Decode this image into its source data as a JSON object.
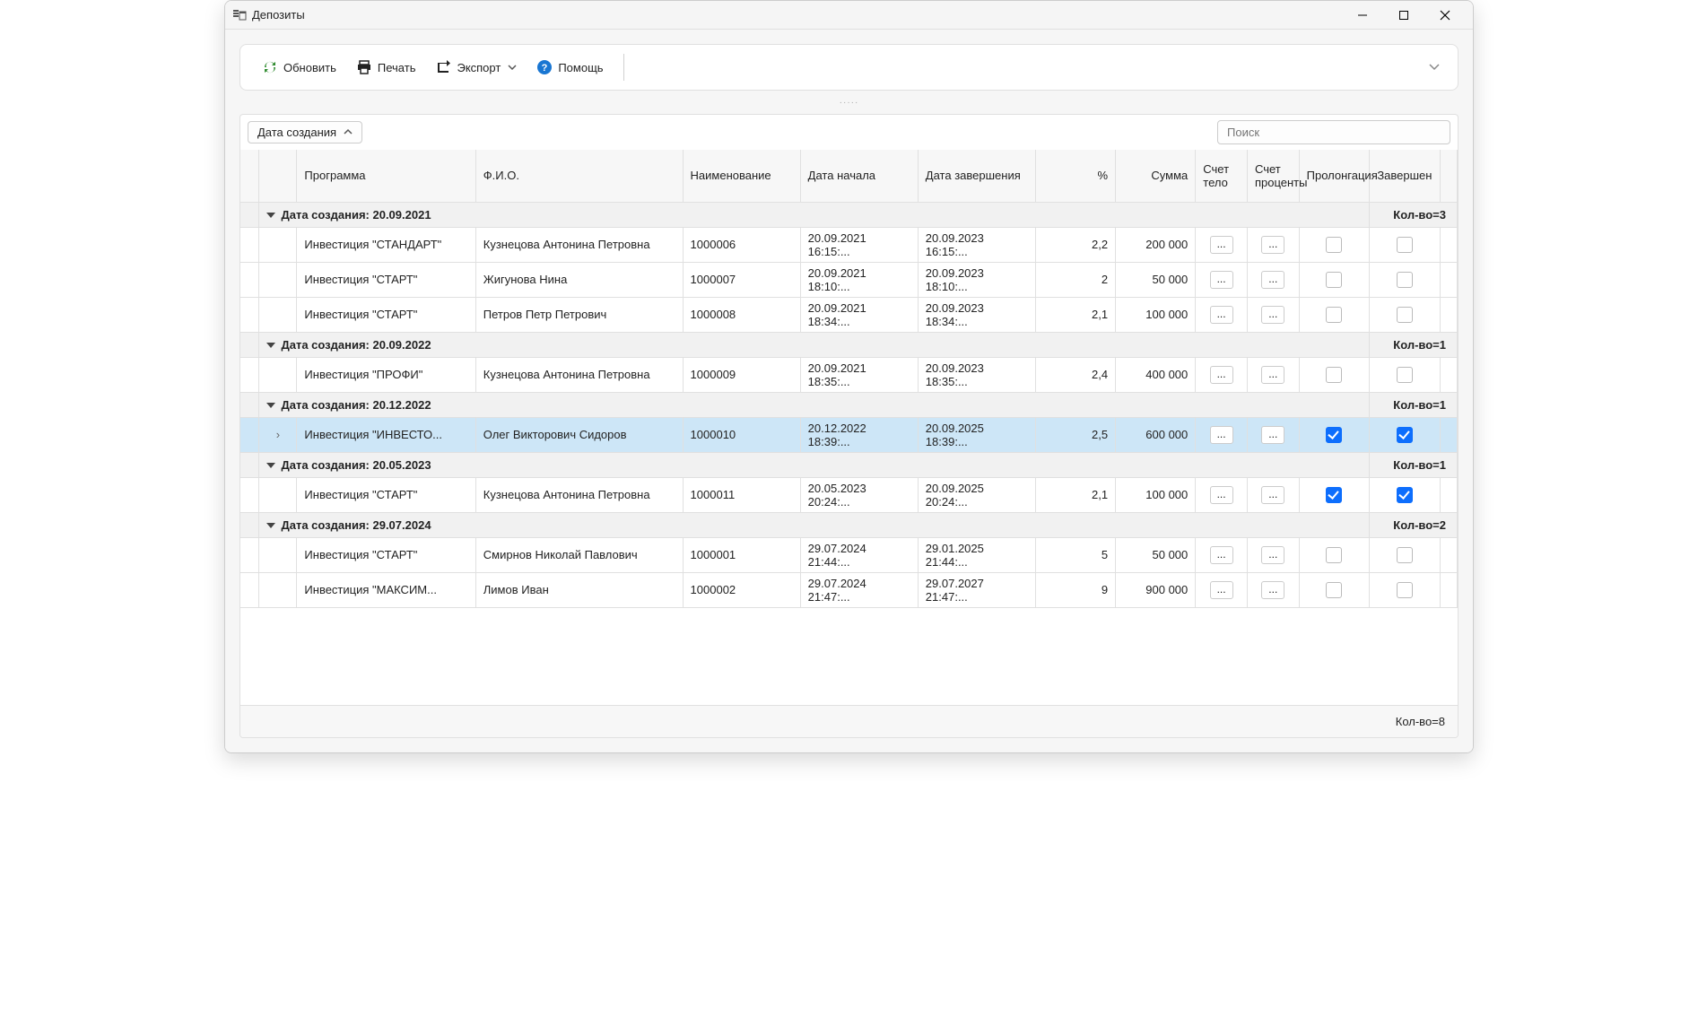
{
  "window": {
    "title": "Депозиты"
  },
  "toolbar": {
    "refresh": "Обновить",
    "print": "Печать",
    "export": "Экспорт",
    "help": "Помощь"
  },
  "group": {
    "chip_label": "Дата создания"
  },
  "search": {
    "placeholder": "Поиск"
  },
  "columns": {
    "program": "Программа",
    "fio": "Ф.И.О.",
    "name": "Наименование",
    "date_start": "Дата начала",
    "date_end": "Дата завершения",
    "percent": "%",
    "sum": "Сумма",
    "acct_body": "Счет тело",
    "acct_pct": "Счет проценты",
    "prolong": "Пролонгация",
    "done": "Завершен"
  },
  "groups": [
    {
      "label": "Дата создания: 20.09.2021",
      "count_label": "Кол-во=3",
      "rows": [
        {
          "program": "Инвестиция \"СТАНДАРТ\"",
          "fio": "Кузнецова Антонина Петровна",
          "name": "1000006",
          "dstart": "20.09.2021 16:15:...",
          "dend": "20.09.2023 16:15:...",
          "pct": "2,2",
          "sum": "200 000",
          "prolong": false,
          "done": false,
          "selected": false
        },
        {
          "program": "Инвестиция \"СТАРТ\"",
          "fio": "Жигунова Нина",
          "name": "1000007",
          "dstart": "20.09.2021 18:10:...",
          "dend": "20.09.2023 18:10:...",
          "pct": "2",
          "sum": "50 000",
          "prolong": false,
          "done": false,
          "selected": false
        },
        {
          "program": "Инвестиция \"СТАРТ\"",
          "fio": "Петров Петр Петрович",
          "name": "1000008",
          "dstart": "20.09.2021 18:34:...",
          "dend": "20.09.2023 18:34:...",
          "pct": "2,1",
          "sum": "100 000",
          "prolong": false,
          "done": false,
          "selected": false
        }
      ]
    },
    {
      "label": "Дата создания: 20.09.2022",
      "count_label": "Кол-во=1",
      "rows": [
        {
          "program": "Инвестиция \"ПРОФИ\"",
          "fio": "Кузнецова Антонина Петровна",
          "name": "1000009",
          "dstart": "20.09.2021 18:35:...",
          "dend": "20.09.2023 18:35:...",
          "pct": "2,4",
          "sum": "400 000",
          "prolong": false,
          "done": false,
          "selected": false
        }
      ]
    },
    {
      "label": "Дата создания: 20.12.2022",
      "count_label": "Кол-во=1",
      "rows": [
        {
          "program": "Инвестиция \"ИНВЕСТО...",
          "fio": "Олег Викторович Сидоров",
          "name": "1000010",
          "dstart": "20.12.2022 18:39:...",
          "dend": "20.09.2025 18:39:...",
          "pct": "2,5",
          "sum": "600 000",
          "prolong": true,
          "done": true,
          "selected": true
        }
      ]
    },
    {
      "label": "Дата создания: 20.05.2023",
      "count_label": "Кол-во=1",
      "rows": [
        {
          "program": "Инвестиция \"СТАРТ\"",
          "fio": "Кузнецова Антонина Петровна",
          "name": "1000011",
          "dstart": "20.05.2023 20:24:...",
          "dend": "20.09.2025 20:24:...",
          "pct": "2,1",
          "sum": "100 000",
          "prolong": true,
          "done": true,
          "selected": false
        }
      ]
    },
    {
      "label": "Дата создания: 29.07.2024",
      "count_label": "Кол-во=2",
      "rows": [
        {
          "program": "Инвестиция \"СТАРТ\"",
          "fio": "Смирнов Николай Павлович",
          "name": "1000001",
          "dstart": "29.07.2024 21:44:...",
          "dend": "29.01.2025 21:44:...",
          "pct": "5",
          "sum": "50 000",
          "prolong": false,
          "done": false,
          "selected": false
        },
        {
          "program": "Инвестиция \"МАКСИМ...",
          "fio": "Лимов Иван",
          "name": "1000002",
          "dstart": "29.07.2024 21:47:...",
          "dend": "29.07.2027 21:47:...",
          "pct": "9",
          "sum": "900 000",
          "prolong": false,
          "done": false,
          "selected": false
        }
      ]
    }
  ],
  "footer": {
    "total_label": "Кол-во=8"
  },
  "glyphs": {
    "dots": "..."
  }
}
